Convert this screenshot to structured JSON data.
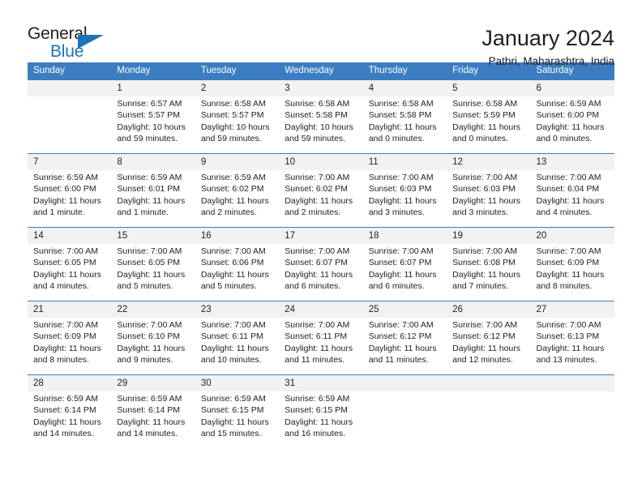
{
  "brand": {
    "name_part1": "General",
    "name_part2": "Blue",
    "accent_color": "#1b72b8"
  },
  "header": {
    "title": "January 2024",
    "subtitle": "Pathri, Maharashtra, India"
  },
  "theme": {
    "header_bg": "#3b7dc0",
    "daynum_bg": "#f2f2f2",
    "text": "#222222"
  },
  "calendar": {
    "weekday_headers": [
      "Sunday",
      "Monday",
      "Tuesday",
      "Wednesday",
      "Thursday",
      "Friday",
      "Saturday"
    ],
    "weeks": [
      [
        {
          "day": "",
          "sunrise": "",
          "sunset": "",
          "daylight1": "",
          "daylight2": ""
        },
        {
          "day": "1",
          "sunrise": "Sunrise: 6:57 AM",
          "sunset": "Sunset: 5:57 PM",
          "daylight1": "Daylight: 10 hours",
          "daylight2": "and 59 minutes."
        },
        {
          "day": "2",
          "sunrise": "Sunrise: 6:58 AM",
          "sunset": "Sunset: 5:57 PM",
          "daylight1": "Daylight: 10 hours",
          "daylight2": "and 59 minutes."
        },
        {
          "day": "3",
          "sunrise": "Sunrise: 6:58 AM",
          "sunset": "Sunset: 5:58 PM",
          "daylight1": "Daylight: 10 hours",
          "daylight2": "and 59 minutes."
        },
        {
          "day": "4",
          "sunrise": "Sunrise: 6:58 AM",
          "sunset": "Sunset: 5:58 PM",
          "daylight1": "Daylight: 11 hours",
          "daylight2": "and 0 minutes."
        },
        {
          "day": "5",
          "sunrise": "Sunrise: 6:58 AM",
          "sunset": "Sunset: 5:59 PM",
          "daylight1": "Daylight: 11 hours",
          "daylight2": "and 0 minutes."
        },
        {
          "day": "6",
          "sunrise": "Sunrise: 6:59 AM",
          "sunset": "Sunset: 6:00 PM",
          "daylight1": "Daylight: 11 hours",
          "daylight2": "and 0 minutes."
        }
      ],
      [
        {
          "day": "7",
          "sunrise": "Sunrise: 6:59 AM",
          "sunset": "Sunset: 6:00 PM",
          "daylight1": "Daylight: 11 hours",
          "daylight2": "and 1 minute."
        },
        {
          "day": "8",
          "sunrise": "Sunrise: 6:59 AM",
          "sunset": "Sunset: 6:01 PM",
          "daylight1": "Daylight: 11 hours",
          "daylight2": "and 1 minute."
        },
        {
          "day": "9",
          "sunrise": "Sunrise: 6:59 AM",
          "sunset": "Sunset: 6:02 PM",
          "daylight1": "Daylight: 11 hours",
          "daylight2": "and 2 minutes."
        },
        {
          "day": "10",
          "sunrise": "Sunrise: 7:00 AM",
          "sunset": "Sunset: 6:02 PM",
          "daylight1": "Daylight: 11 hours",
          "daylight2": "and 2 minutes."
        },
        {
          "day": "11",
          "sunrise": "Sunrise: 7:00 AM",
          "sunset": "Sunset: 6:03 PM",
          "daylight1": "Daylight: 11 hours",
          "daylight2": "and 3 minutes."
        },
        {
          "day": "12",
          "sunrise": "Sunrise: 7:00 AM",
          "sunset": "Sunset: 6:03 PM",
          "daylight1": "Daylight: 11 hours",
          "daylight2": "and 3 minutes."
        },
        {
          "day": "13",
          "sunrise": "Sunrise: 7:00 AM",
          "sunset": "Sunset: 6:04 PM",
          "daylight1": "Daylight: 11 hours",
          "daylight2": "and 4 minutes."
        }
      ],
      [
        {
          "day": "14",
          "sunrise": "Sunrise: 7:00 AM",
          "sunset": "Sunset: 6:05 PM",
          "daylight1": "Daylight: 11 hours",
          "daylight2": "and 4 minutes."
        },
        {
          "day": "15",
          "sunrise": "Sunrise: 7:00 AM",
          "sunset": "Sunset: 6:05 PM",
          "daylight1": "Daylight: 11 hours",
          "daylight2": "and 5 minutes."
        },
        {
          "day": "16",
          "sunrise": "Sunrise: 7:00 AM",
          "sunset": "Sunset: 6:06 PM",
          "daylight1": "Daylight: 11 hours",
          "daylight2": "and 5 minutes."
        },
        {
          "day": "17",
          "sunrise": "Sunrise: 7:00 AM",
          "sunset": "Sunset: 6:07 PM",
          "daylight1": "Daylight: 11 hours",
          "daylight2": "and 6 minutes."
        },
        {
          "day": "18",
          "sunrise": "Sunrise: 7:00 AM",
          "sunset": "Sunset: 6:07 PM",
          "daylight1": "Daylight: 11 hours",
          "daylight2": "and 6 minutes."
        },
        {
          "day": "19",
          "sunrise": "Sunrise: 7:00 AM",
          "sunset": "Sunset: 6:08 PM",
          "daylight1": "Daylight: 11 hours",
          "daylight2": "and 7 minutes."
        },
        {
          "day": "20",
          "sunrise": "Sunrise: 7:00 AM",
          "sunset": "Sunset: 6:09 PM",
          "daylight1": "Daylight: 11 hours",
          "daylight2": "and 8 minutes."
        }
      ],
      [
        {
          "day": "21",
          "sunrise": "Sunrise: 7:00 AM",
          "sunset": "Sunset: 6:09 PM",
          "daylight1": "Daylight: 11 hours",
          "daylight2": "and 8 minutes."
        },
        {
          "day": "22",
          "sunrise": "Sunrise: 7:00 AM",
          "sunset": "Sunset: 6:10 PM",
          "daylight1": "Daylight: 11 hours",
          "daylight2": "and 9 minutes."
        },
        {
          "day": "23",
          "sunrise": "Sunrise: 7:00 AM",
          "sunset": "Sunset: 6:11 PM",
          "daylight1": "Daylight: 11 hours",
          "daylight2": "and 10 minutes."
        },
        {
          "day": "24",
          "sunrise": "Sunrise: 7:00 AM",
          "sunset": "Sunset: 6:11 PM",
          "daylight1": "Daylight: 11 hours",
          "daylight2": "and 11 minutes."
        },
        {
          "day": "25",
          "sunrise": "Sunrise: 7:00 AM",
          "sunset": "Sunset: 6:12 PM",
          "daylight1": "Daylight: 11 hours",
          "daylight2": "and 11 minutes."
        },
        {
          "day": "26",
          "sunrise": "Sunrise: 7:00 AM",
          "sunset": "Sunset: 6:12 PM",
          "daylight1": "Daylight: 11 hours",
          "daylight2": "and 12 minutes."
        },
        {
          "day": "27",
          "sunrise": "Sunrise: 7:00 AM",
          "sunset": "Sunset: 6:13 PM",
          "daylight1": "Daylight: 11 hours",
          "daylight2": "and 13 minutes."
        }
      ],
      [
        {
          "day": "28",
          "sunrise": "Sunrise: 6:59 AM",
          "sunset": "Sunset: 6:14 PM",
          "daylight1": "Daylight: 11 hours",
          "daylight2": "and 14 minutes."
        },
        {
          "day": "29",
          "sunrise": "Sunrise: 6:59 AM",
          "sunset": "Sunset: 6:14 PM",
          "daylight1": "Daylight: 11 hours",
          "daylight2": "and 14 minutes."
        },
        {
          "day": "30",
          "sunrise": "Sunrise: 6:59 AM",
          "sunset": "Sunset: 6:15 PM",
          "daylight1": "Daylight: 11 hours",
          "daylight2": "and 15 minutes."
        },
        {
          "day": "31",
          "sunrise": "Sunrise: 6:59 AM",
          "sunset": "Sunset: 6:15 PM",
          "daylight1": "Daylight: 11 hours",
          "daylight2": "and 16 minutes."
        },
        {
          "day": "",
          "sunrise": "",
          "sunset": "",
          "daylight1": "",
          "daylight2": ""
        },
        {
          "day": "",
          "sunrise": "",
          "sunset": "",
          "daylight1": "",
          "daylight2": ""
        },
        {
          "day": "",
          "sunrise": "",
          "sunset": "",
          "daylight1": "",
          "daylight2": ""
        }
      ]
    ]
  }
}
